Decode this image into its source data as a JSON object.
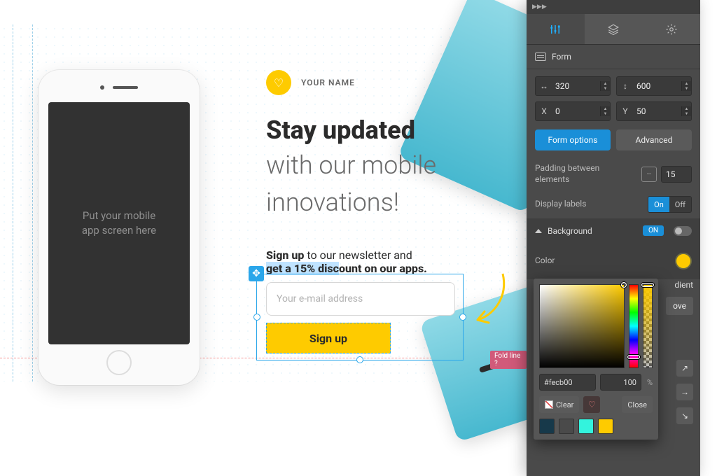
{
  "canvas": {
    "brand_label": "YOUR NAME",
    "hero_strong": "Stay updated",
    "hero_rest1": "with our mobile",
    "hero_rest2": "innovations!",
    "sub_bold": "Sign up",
    "sub_rest": " to our newsletter and",
    "sub_line2_a": "get a 15% disc",
    "sub_line2_b": "ount on our apps.",
    "email_placeholder": "Your e-mail address",
    "signup_label": "Sign up",
    "phone_placeholder1": "Put your mobile",
    "phone_placeholder2": "app screen here",
    "fold_label": "Fold line ?"
  },
  "panel": {
    "element_label": "Form",
    "width": "320",
    "height": "600",
    "x": "0",
    "y": "50",
    "form_options": "Form options",
    "advanced": "Advanced",
    "padding_label": "Padding between elements",
    "padding_value": "15",
    "display_labels": "Display labels",
    "on": "On",
    "off": "Off",
    "background_label": "Background",
    "background_state": "ON",
    "color_label": "Color",
    "gradient_hint": "dient",
    "covered_btn": "ove",
    "picker": {
      "hex": "#fecb00",
      "opacity": "100",
      "clear": "Clear",
      "close": "Close",
      "swatches": [
        "#17394a",
        "#4a4a4a",
        "#33f3dd",
        "#fecb00"
      ]
    }
  }
}
